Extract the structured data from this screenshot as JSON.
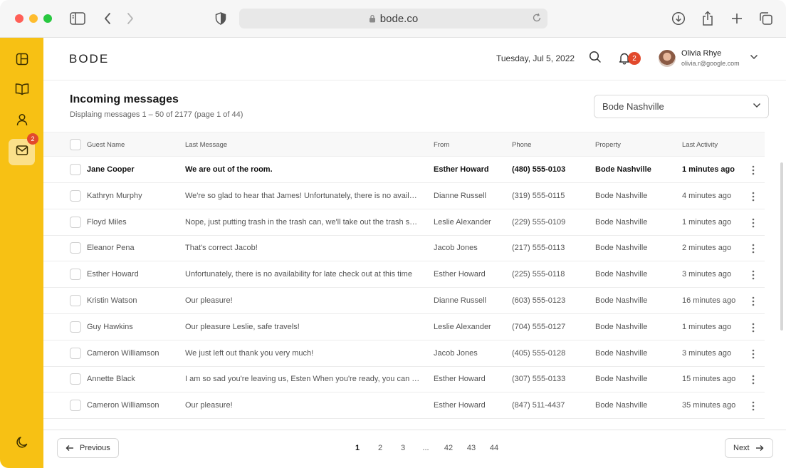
{
  "browser": {
    "url": "bode.co"
  },
  "sidebar": {
    "badge": "2"
  },
  "header": {
    "logo": "BODE",
    "date": "Tuesday, Jul 5, 2022",
    "bell_badge": "2",
    "user_name": "Olivia Rhye",
    "user_email": "olivia.r@google.com"
  },
  "main": {
    "title": "Incoming messages",
    "subtitle": "Displaing messages 1 – 50 of 2177 (page 1 of 44)",
    "property_select": "Bode Nashville"
  },
  "table": {
    "columns": [
      "Guest Name",
      "Last Message",
      "From",
      "Phone",
      "Property",
      "Last Activity"
    ],
    "rows": [
      {
        "guest": "Jane Cooper",
        "message": "We are out of the room.",
        "from": "Esther Howard",
        "phone": "(480) 555-0103",
        "property": "Bode Nashville",
        "activity": "1 minutes ago",
        "unread": true
      },
      {
        "guest": "Kathryn Murphy",
        "message": "We're so glad to hear that James! Unfortunately, there is no availability",
        "from": "Dianne Russell",
        "phone": "(319) 555-0115",
        "property": "Bode Nashville",
        "activity": "4 minutes ago",
        "unread": false
      },
      {
        "guest": "Floyd Miles",
        "message": "Nope, just putting trash in the trash can, we'll take out the trash soon",
        "from": "Leslie Alexander",
        "phone": "(229) 555-0109",
        "property": "Bode Nashville",
        "activity": "1 minutes ago",
        "unread": false
      },
      {
        "guest": "Eleanor Pena",
        "message": "That's correct Jacob!",
        "from": "Jacob Jones",
        "phone": "(217) 555-0113",
        "property": "Bode Nashville",
        "activity": "2 minutes ago",
        "unread": false
      },
      {
        "guest": "Esther Howard",
        "message": "Unfortunately, there is no availability for late check out at this time",
        "from": "Esther Howard",
        "phone": "(225) 555-0118",
        "property": "Bode Nashville",
        "activity": "3 minutes ago",
        "unread": false
      },
      {
        "guest": "Kristin Watson",
        "message": "Our pleasure!",
        "from": "Dianne Russell",
        "phone": "(603) 555-0123",
        "property": "Bode Nashville",
        "activity": "16 minutes ago",
        "unread": false
      },
      {
        "guest": "Guy Hawkins",
        "message": "Our pleasure Leslie, safe travels!",
        "from": "Leslie Alexander",
        "phone": "(704) 555-0127",
        "property": "Bode Nashville",
        "activity": "1 minutes ago",
        "unread": false
      },
      {
        "guest": "Cameron Williamson",
        "message": "We just left out thank you very much!",
        "from": "Jacob Jones",
        "phone": "(405) 555-0128",
        "property": "Bode Nashville",
        "activity": "3 minutes ago",
        "unread": false
      },
      {
        "guest": "Annette Black",
        "message": "I am so sad you're leaving us, Esten When you're ready, you can check out",
        "from": "Esther Howard",
        "phone": "(307) 555-0133",
        "property": "Bode Nashville",
        "activity": "15 minutes ago",
        "unread": false
      },
      {
        "guest": "Cameron Williamson",
        "message": "Our pleasure!",
        "from": "Esther Howard",
        "phone": "(847) 511-4437",
        "property": "Bode Nashville",
        "activity": "35 minutes ago",
        "unread": false
      }
    ]
  },
  "pagination": {
    "previous": "Previous",
    "next": "Next",
    "pages": [
      "1",
      "2",
      "3",
      "...",
      "42",
      "43",
      "44"
    ],
    "current": "1"
  }
}
